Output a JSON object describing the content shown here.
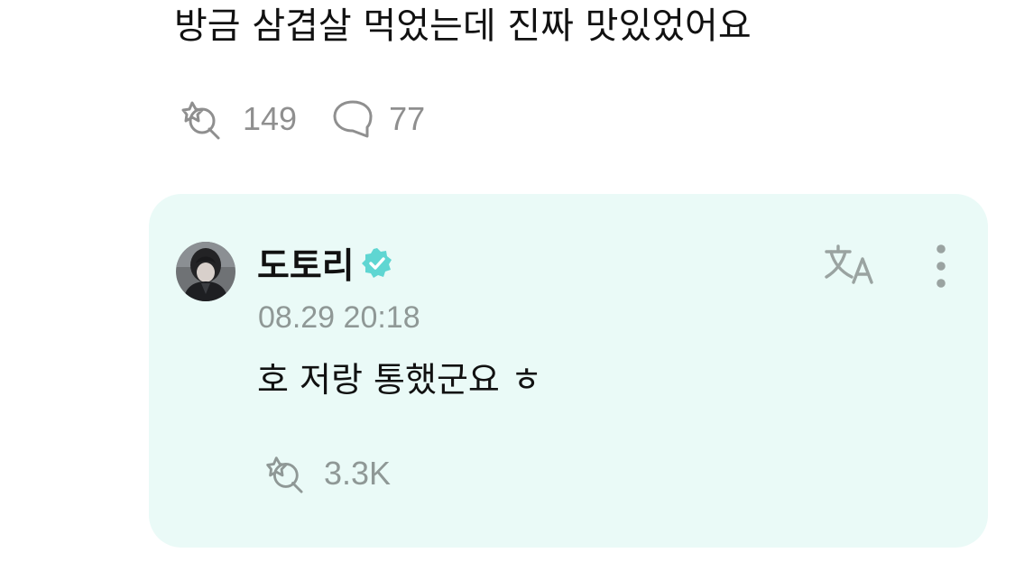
{
  "post": {
    "text": "방금 삼겹살 먹었는데 진짜 맛있었어요",
    "like_count": "149",
    "comment_count": "77",
    "icons": {
      "like": "lightstick-heart-icon",
      "comment": "speech-bubble-icon"
    }
  },
  "reply": {
    "author": "도토리",
    "verified": true,
    "timestamp": "08.29 20:18",
    "text": "호 저랑 통했군요 ㅎ",
    "like_count": "3.3K",
    "icons": {
      "like": "lightstick-heart-icon",
      "translate": "translate-icon",
      "more": "more-vertical-icon",
      "verified": "verified-badge-icon"
    }
  },
  "colors": {
    "card_background": "#eafaf7",
    "verified_badge": "#5fd6d2",
    "muted_text": "#8f8f8f",
    "icon_gray": "#9aa3a1"
  }
}
